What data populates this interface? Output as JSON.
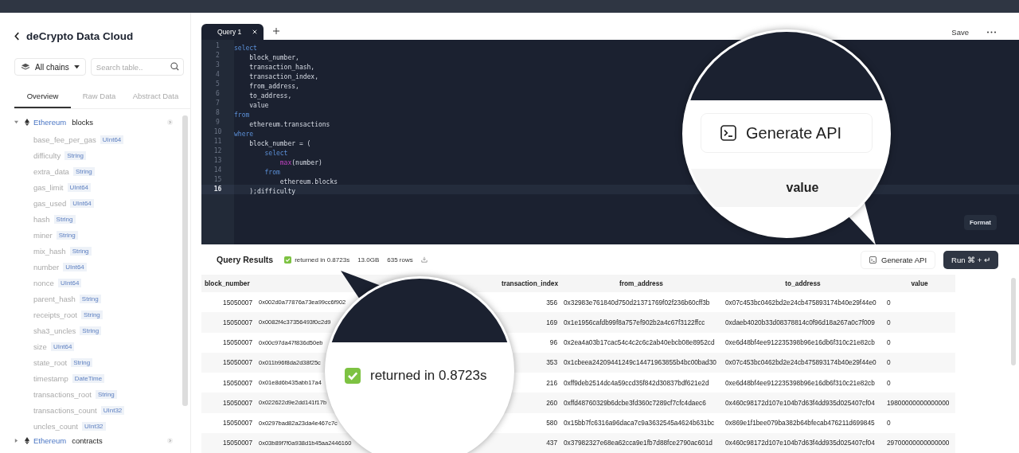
{
  "sidebar": {
    "title": "deCrypto Data Cloud",
    "chain_filter": "All chains",
    "search": {
      "placeholder": "Search table.."
    },
    "tabs": [
      {
        "label": "Overview",
        "selected": true
      },
      {
        "label": "Raw Data",
        "selected": false
      },
      {
        "label": "Abstract Data",
        "selected": false
      }
    ],
    "tree": [
      {
        "chain": "Ethereum",
        "table": "blocks",
        "expanded": true,
        "children": [
          {
            "name": "base_fee_per_gas",
            "type": "UInt64"
          },
          {
            "name": "difficulty",
            "type": "String"
          },
          {
            "name": "extra_data",
            "type": "String"
          },
          {
            "name": "gas_limit",
            "type": "UInt64"
          },
          {
            "name": "gas_used",
            "type": "UInt64"
          },
          {
            "name": "hash",
            "type": "String"
          },
          {
            "name": "miner",
            "type": "String"
          },
          {
            "name": "mix_hash",
            "type": "String"
          },
          {
            "name": "number",
            "type": "UInt64"
          },
          {
            "name": "nonce",
            "type": "UInt64"
          },
          {
            "name": "parent_hash",
            "type": "String"
          },
          {
            "name": "receipts_root",
            "type": "String"
          },
          {
            "name": "sha3_uncles",
            "type": "String"
          },
          {
            "name": "size",
            "type": "UInt64"
          },
          {
            "name": "state_root",
            "type": "String"
          },
          {
            "name": "timestamp",
            "type": "DateTime"
          },
          {
            "name": "transactions_root",
            "type": "String"
          },
          {
            "name": "transactions_count",
            "type": "UInt32"
          },
          {
            "name": "uncles_count",
            "type": "UInt32"
          }
        ]
      },
      {
        "chain": "Ethereum",
        "table": "contracts",
        "expanded": false
      }
    ]
  },
  "editor": {
    "tabs": [
      {
        "label": "Query 1",
        "selected": true
      }
    ],
    "save": "Save",
    "format": "Format",
    "lines": [
      {
        "n": "1",
        "current": false,
        "tokens": [
          {
            "t": "select",
            "kind": "keyword"
          }
        ]
      },
      {
        "n": "2",
        "current": false,
        "tokens": [
          {
            "t": "    block_number,",
            "kind": "plain"
          }
        ]
      },
      {
        "n": "3",
        "current": false,
        "tokens": [
          {
            "t": "    transaction_hash,",
            "kind": "plain"
          }
        ]
      },
      {
        "n": "4",
        "current": false,
        "tokens": [
          {
            "t": "    transaction_index,",
            "kind": "plain"
          }
        ]
      },
      {
        "n": "5",
        "current": false,
        "tokens": [
          {
            "t": "    from_address,",
            "kind": "plain"
          }
        ]
      },
      {
        "n": "6",
        "current": false,
        "tokens": [
          {
            "t": "    to_address,",
            "kind": "plain"
          }
        ]
      },
      {
        "n": "7",
        "current": false,
        "tokens": [
          {
            "t": "    value",
            "kind": "plain"
          }
        ]
      },
      {
        "n": "8",
        "current": false,
        "tokens": [
          {
            "t": "from",
            "kind": "keyword"
          }
        ]
      },
      {
        "n": "9",
        "current": false,
        "tokens": [
          {
            "t": "    ethereum.transactions",
            "kind": "plain"
          }
        ]
      },
      {
        "n": "10",
        "current": false,
        "tokens": [
          {
            "t": "where",
            "kind": "keyword"
          }
        ]
      },
      {
        "n": "11",
        "current": false,
        "tokens": [
          {
            "t": "    block_number = (",
            "kind": "plain"
          }
        ]
      },
      {
        "n": "12",
        "current": false,
        "tokens": [
          {
            "t": "        select",
            "kind": "keyword"
          }
        ]
      },
      {
        "n": "13",
        "current": false,
        "tokens": [
          {
            "t": "            max",
            "kind": "function"
          },
          {
            "t": "(number)",
            "kind": "plain"
          }
        ]
      },
      {
        "n": "14",
        "current": false,
        "tokens": [
          {
            "t": "        from",
            "kind": "keyword"
          }
        ]
      },
      {
        "n": "15",
        "current": false,
        "tokens": [
          {
            "t": "            ethereum.blocks",
            "kind": "plain"
          }
        ]
      },
      {
        "n": "16",
        "current": true,
        "tokens": [
          {
            "t": "    );difficulty",
            "kind": "plain"
          }
        ]
      }
    ]
  },
  "results": {
    "title": "Query Results",
    "status": "returned in 0.8723s",
    "size": "13.0GB",
    "row_count": "635 rows",
    "generate_api": "Generate API",
    "run": "Run ⌘ + ↵",
    "columns": [
      "block_number",
      "",
      "transaction_index",
      "from_address",
      "to_address",
      "value"
    ],
    "rows": [
      [
        "15050007",
        "0x002d0a77876a73ea99cc6f902",
        "356",
        "0x32983e761840d750d21371769f02f236b60cff3b",
        "0x07c453bc0462bd2e24cb475893174b40e29f44e0",
        "0"
      ],
      [
        "15050007",
        "0x0082f4c37356493f0c2d9",
        "169",
        "0x1e1956cafdb99f8a757ef902b2a4c67f3122ffcc",
        "0xdaeb4020b33d08378814c0f96d18a267a0c7f009",
        "0"
      ],
      [
        "15050007",
        "0x00c97da47f836d50eb",
        "96",
        "0x2ea4a03b17cac54c4c2c6c2ab40ebcb08e8952cd",
        "0xe6d48bf4ee912235398b96e16db6f310c21e82cb",
        "0"
      ],
      [
        "15050007",
        "0x011b96f8da2d38f25c",
        "353",
        "0x1cbeea24209441249c14471963855b4bc00bad30",
        "0x07c453bc0462bd2e24cb475893174b40e29f44e0",
        "0"
      ],
      [
        "15050007",
        "0x01e8d6b435abb17a4",
        "216",
        "0xff9deb2514dc4a59ccd35f842d30837bdf621e2d",
        "0xe6d48bf4ee912235398b96e16db6f310c21e82cb",
        "0"
      ],
      [
        "15050007",
        "0x022622d9e2dd141f17b",
        "260",
        "0xffd48760329b6dcbe3fd360c7289cf7cfc4daec6",
        "0x460c98172d107e104b7d63f4dd935d025407cf04",
        "19800000000000000"
      ],
      [
        "15050007",
        "0x0297bad82a23da4e467c7c",
        "580",
        "0x15bb7fc6316a96daca7c9a3632545a4624b631bc",
        "0x869e1f1bee079ba382b64bfecab476211d699845",
        "0"
      ],
      [
        "15050007",
        "0x03b89f7f0a938d1b45aa2446160",
        "437",
        "0x37982327e68ea62cca9e1fb7d88fce2790ac601d",
        "0x460c98172d107e104b7d63f4dd935d025407cf04",
        "29700000000000000"
      ]
    ]
  },
  "callouts": [
    {
      "kind": "button",
      "text": "Generate API",
      "column": "value"
    },
    {
      "kind": "status",
      "text": "returned in 0.8723s"
    }
  ]
}
